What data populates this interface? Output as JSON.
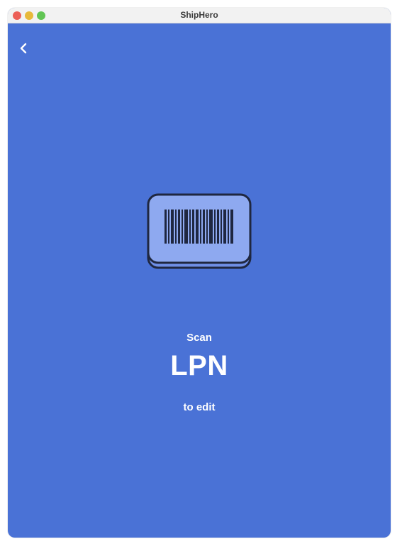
{
  "window": {
    "title": "ShipHero"
  },
  "icons": {
    "back": "chevron-left-icon",
    "barcode": "barcode-icon"
  },
  "colors": {
    "background": "#4a72d6",
    "card": "#8ea9f0",
    "outline": "#1f2740",
    "text": "#ffffff"
  },
  "prompt": {
    "line1": "Scan",
    "target": "LPN",
    "line3": "to edit"
  }
}
